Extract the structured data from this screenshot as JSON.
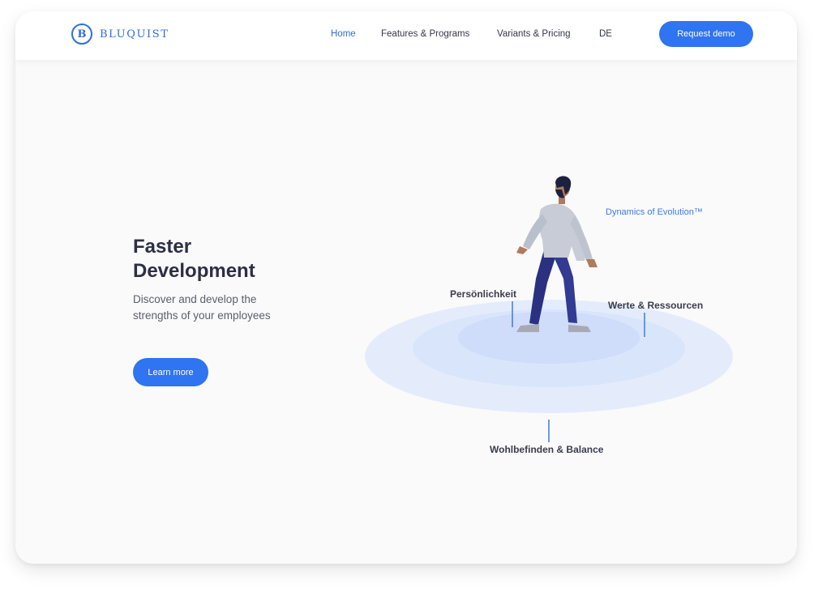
{
  "brand": {
    "name": "BLUQUIST",
    "mark": "B"
  },
  "nav": {
    "items": [
      {
        "label": "Home",
        "active": true
      },
      {
        "label": "Features & Programs",
        "active": false
      },
      {
        "label": "Variants & Pricing",
        "active": false
      },
      {
        "label": "DE",
        "active": false
      }
    ],
    "cta_label": "Request demo"
  },
  "hero": {
    "title": "Faster Development",
    "subtitle": "Discover and develop the strengths of your employees",
    "button_label": "Learn more"
  },
  "illustration": {
    "labels": {
      "dynamics": "Dynamics of Evolution™",
      "personality": "Persönlichkeit",
      "values": "Werte & Ressourcen",
      "wellbeing": "Wohlbefinden & Balance"
    }
  },
  "colors": {
    "accent": "#2f74f0",
    "brand": "#2f6fd6",
    "text_dark": "#2c2f45",
    "ring_outer": "#e6eefc",
    "ring_middle": "#dbe6fb",
    "ring_inner": "#d2dffa"
  }
}
